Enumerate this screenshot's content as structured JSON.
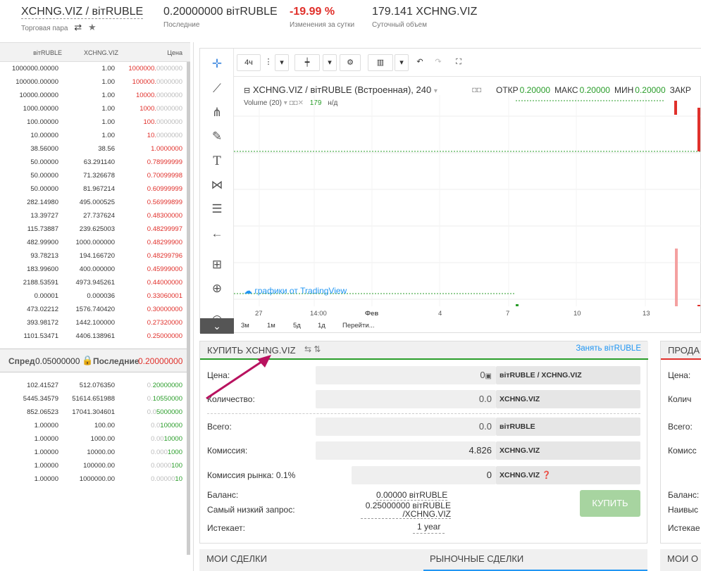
{
  "header": {
    "pair": "XCHNG.VIZ / вітRUBLE",
    "pair_label": "Торговая пара",
    "last_price": "0.20000000 вітRUBLE",
    "last_label": "Последние",
    "change": "-19.99 %",
    "change_label": "Изменения за сутки",
    "volume": "179.141 XCHNG.VIZ",
    "volume_label": "Суточный объем"
  },
  "orderbook": {
    "headers": [
      "вітRUBLE",
      "XCHNG.VIZ",
      "Цена"
    ],
    "asks": [
      [
        "1000000.00000",
        "1.00",
        "1000000.",
        "0000000"
      ],
      [
        "100000.00000",
        "1.00",
        "100000.",
        "0000000"
      ],
      [
        "10000.00000",
        "1.00",
        "10000.",
        "0000000"
      ],
      [
        "1000.00000",
        "1.00",
        "1000.",
        "0000000"
      ],
      [
        "100.00000",
        "1.00",
        "100.",
        "0000000"
      ],
      [
        "10.00000",
        "1.00",
        "10.",
        "0000000"
      ],
      [
        "38.56000",
        "38.56",
        "1.0000000",
        ""
      ],
      [
        "50.00000",
        "63.291140",
        "0.78999999",
        ""
      ],
      [
        "50.00000",
        "71.326678",
        "0.70099998",
        ""
      ],
      [
        "50.00000",
        "81.967214",
        "0.60999999",
        ""
      ],
      [
        "282.14980",
        "495.000525",
        "0.56999899",
        ""
      ],
      [
        "13.39727",
        "27.737624",
        "0.48300000",
        ""
      ],
      [
        "115.73887",
        "239.625003",
        "0.48299997",
        ""
      ],
      [
        "482.99900",
        "1000.000000",
        "0.48299900",
        ""
      ],
      [
        "93.78213",
        "194.166720",
        "0.48299796",
        ""
      ],
      [
        "183.99600",
        "400.000000",
        "0.45999000",
        ""
      ],
      [
        "2188.53591",
        "4973.945261",
        "0.44000000",
        ""
      ],
      [
        "0.00001",
        "0.000036",
        "0.33060001",
        ""
      ],
      [
        "473.02212",
        "1576.740420",
        "0.30000000",
        ""
      ],
      [
        "393.98172",
        "1442.100000",
        "0.27320000",
        ""
      ],
      [
        "1101.53471",
        "4406.138961",
        "0.25000000",
        ""
      ]
    ],
    "spread_label": "Спред",
    "spread_value": "0.05000000",
    "last_label": "Последние",
    "last_value": "0.20000000",
    "bids": [
      [
        "102.41527",
        "512.076350",
        "0.",
        "20000000"
      ],
      [
        "5445.34579",
        "51614.651988",
        "0.",
        "10550000"
      ],
      [
        "852.06523",
        "17041.304601",
        "0.0",
        "5000000"
      ],
      [
        "1.00000",
        "100.00",
        "0.0",
        "100000"
      ],
      [
        "1.00000",
        "1000.00",
        "0.00",
        "10000"
      ],
      [
        "1.00000",
        "10000.00",
        "0.000",
        "1000"
      ],
      [
        "1.00000",
        "100000.00",
        "0.0000",
        "100"
      ],
      [
        "1.00000",
        "1000000.00",
        "0.00000",
        "10"
      ]
    ]
  },
  "chart": {
    "interval": "4ч",
    "symbol_title": "XCHNG.VIZ / вітRUBLE (Встроенная), 240",
    "ohlc": [
      {
        "label": "ОТКР",
        "value": "0.20000"
      },
      {
        "label": "МАКС",
        "value": "0.20000"
      },
      {
        "label": "МИН",
        "value": "0.20000"
      },
      {
        "label": "ЗАКР",
        "value": ""
      }
    ],
    "volume_label": "Volume (20)",
    "volume_value": "179",
    "volume_na": "н/д",
    "watermark": "графики от TradingView",
    "x_ticks": [
      "27",
      "14:00",
      "Фев",
      "4",
      "7",
      "10",
      "13"
    ],
    "periods": [
      "3м",
      "1м",
      "5д",
      "1д",
      "Перейти..."
    ],
    "colors": {
      "up": "#2a9d2a",
      "down": "#e0302b",
      "accent": "#2196f3"
    }
  },
  "buy_form": {
    "title": "КУПИТЬ XCHNG.VIZ",
    "borrow_link": "Занять вітRUBLE",
    "price_label": "Цена:",
    "price_value": "0",
    "price_unit": "вітRUBLE / XCHNG.VIZ",
    "amount_label": "Количество:",
    "amount_value": "0.0",
    "amount_unit": "XCHNG.VIZ",
    "total_label": "Всего:",
    "total_value": "0.0",
    "total_unit": "вітRUBLE",
    "fee_label": "Комиссия:",
    "fee_value": "4.826",
    "fee_unit": "XCHNG.VIZ",
    "market_fee_label": "Комиссия рынка: 0.1%",
    "market_fee_value": "0",
    "market_fee_unit": "XCHNG.VIZ",
    "balance_label": "Баланс:",
    "balance_value": "0.00000 вітRUBLE",
    "lowest_ask_label": "Самый низкий запрос:",
    "lowest_ask_value": "0.25000000 вітRUBLE /XCHNG.VIZ",
    "expires_label": "Истекает:",
    "expires_value": "1 year",
    "buy_button": "КУПИТЬ"
  },
  "sell_form": {
    "title": "ПРОДА",
    "price_label": "Цена:",
    "amount_label": "Колич",
    "total_label": "Всего:",
    "fee_label": "Комисс",
    "balance_label": "Баланс:",
    "lowest_label": "Наивыс",
    "expires_label": "Истекае"
  },
  "bottom_tabs": {
    "my_trades": "МОИ СДЕЛКИ",
    "market_trades": "РЫНОЧНЫЕ СДЕЛКИ",
    "my_orders": "МОИ О"
  }
}
